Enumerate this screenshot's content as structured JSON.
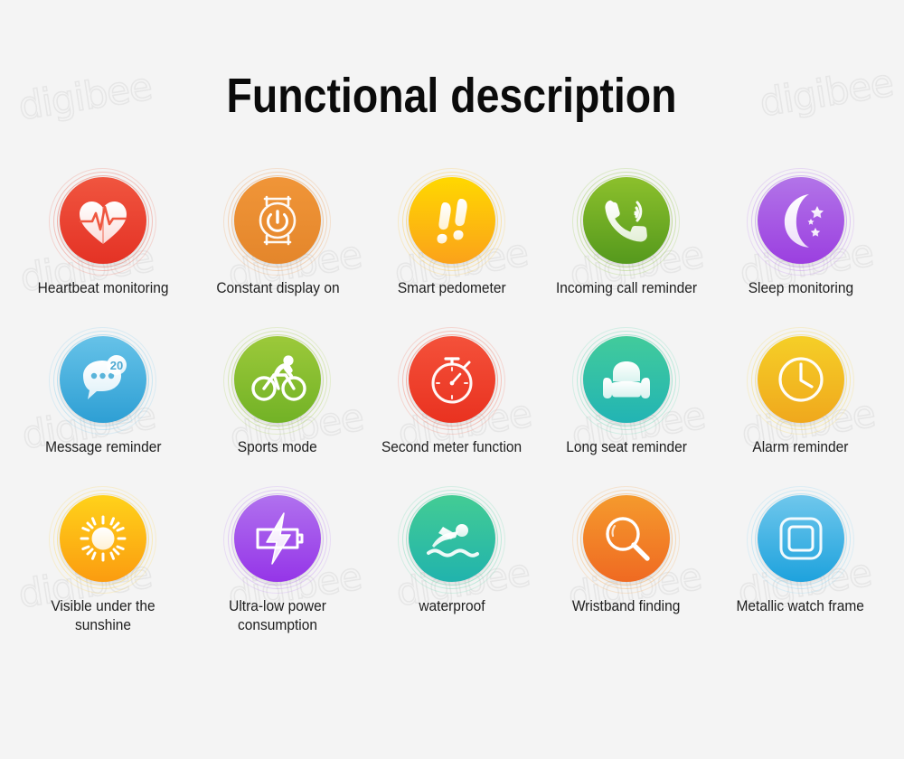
{
  "page": {
    "title": "Functional description",
    "background_color": "#f4f4f4",
    "title_color": "#0b0b0b",
    "label_color": "#1e1e1e",
    "watermark_text": "digibee"
  },
  "features": [
    {
      "label": "Heartbeat monitoring",
      "icon": "heart-pulse-icon",
      "color_from": "#f0553f",
      "color_to": "#e43225",
      "ring_color": "#ef7a6b"
    },
    {
      "label": "Constant display on",
      "icon": "watch-power-icon",
      "color_from": "#f09538",
      "color_to": "#e4862b",
      "ring_color": "#f0a763"
    },
    {
      "label": "Smart pedometer",
      "icon": "footprints-icon",
      "color_from": "#ffd800",
      "color_to": "#fba21a",
      "ring_color": "#fcca4d"
    },
    {
      "label": "Incoming call reminder",
      "icon": "phone-call-icon",
      "color_from": "#8cc02c",
      "color_to": "#55991d",
      "ring_color": "#9ccb55"
    },
    {
      "label": "Sleep monitoring",
      "icon": "moon-stars-icon",
      "color_from": "#b274e8",
      "color_to": "#9b3fe0",
      "ring_color": "#c08df0"
    },
    {
      "label": "Message reminder",
      "icon": "message-bubble-icon",
      "color_from": "#66c2e8",
      "color_to": "#2e9fd4",
      "ring_color": "#8ed2ef"
    },
    {
      "label": "Sports mode",
      "icon": "cyclist-icon",
      "color_from": "#9cc93a",
      "color_to": "#72b226",
      "ring_color": "#b0d465"
    },
    {
      "label": "Second meter function",
      "icon": "stopwatch-icon",
      "color_from": "#f4513a",
      "color_to": "#e93220",
      "ring_color": "#f5806e"
    },
    {
      "label": "Long seat reminder",
      "icon": "armchair-icon",
      "color_from": "#42cb9b",
      "color_to": "#22b4b4",
      "ring_color": "#72dcbb"
    },
    {
      "label": "Alarm reminder",
      "icon": "clock-icon",
      "color_from": "#f5cf27",
      "color_to": "#f0a81d",
      "ring_color": "#f6da60"
    },
    {
      "label": "Visible under the sunshine",
      "icon": "sun-icon",
      "color_from": "#ffd21a",
      "color_to": "#fb9c10",
      "ring_color": "#fcd866"
    },
    {
      "label": "Ultra-low power consumption",
      "icon": "battery-bolt-icon",
      "color_from": "#b071ee",
      "color_to": "#9535e8",
      "ring_color": "#c596f2"
    },
    {
      "label": "waterproof",
      "icon": "swimmer-icon",
      "color_from": "#43cc94",
      "color_to": "#21b3ad",
      "ring_color": "#76dcb7"
    },
    {
      "label": "Wristband finding",
      "icon": "magnifier-icon",
      "color_from": "#f59a2d",
      "color_to": "#ef6a22",
      "ring_color": "#f7b264"
    },
    {
      "label": "Metallic watch frame",
      "icon": "watch-frame-icon",
      "color_from": "#6fc7ec",
      "color_to": "#1ea2dd",
      "ring_color": "#97d8f2"
    }
  ]
}
